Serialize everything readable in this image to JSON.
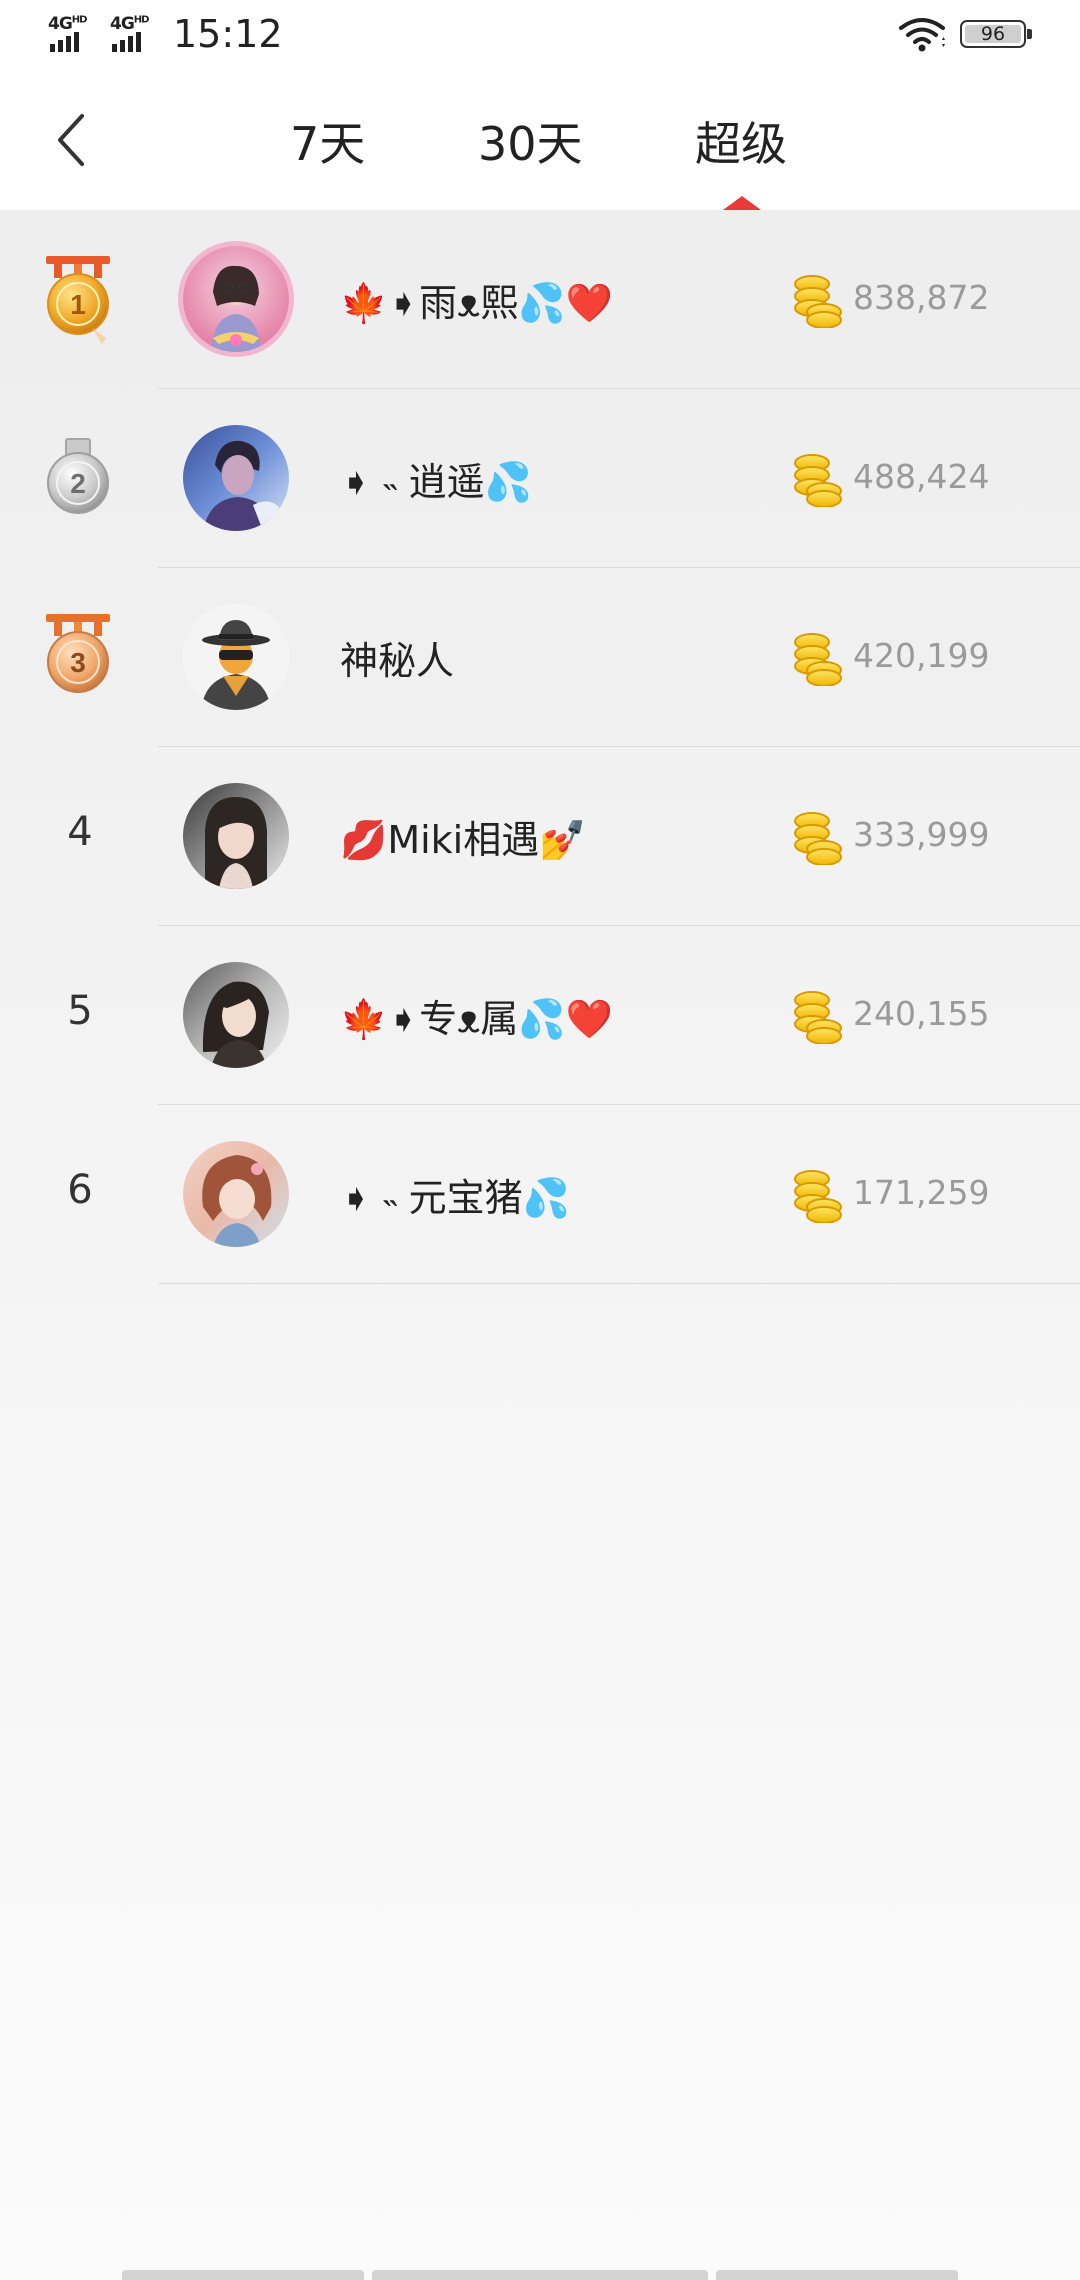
{
  "status_bar": {
    "signal_1_label": "4G",
    "signal_1_sup": "HD",
    "signal_2_label": "4G",
    "signal_2_sup": "HD",
    "time": "15:12",
    "battery": "96"
  },
  "header": {
    "back_icon": "chevron-left-icon",
    "tabs": [
      {
        "label": "7天"
      },
      {
        "label": "30天"
      },
      {
        "label": "超级"
      }
    ],
    "active_tab": 2,
    "accent_color": "#e83a3a"
  },
  "ranking": [
    {
      "rank": "1",
      "medal": "gold",
      "name": "🍁➧雨ᴥ熙💦❤️",
      "score": "838,872"
    },
    {
      "rank": "2",
      "medal": "silver",
      "name": "➧ ˵ 逍遥💦",
      "score": "488,424"
    },
    {
      "rank": "3",
      "medal": "bronze",
      "name": "神秘人",
      "score": "420,199"
    },
    {
      "rank": "4",
      "medal": "",
      "name": "💋Miki相遇💅",
      "score": "333,999"
    },
    {
      "rank": "5",
      "medal": "",
      "name": "🍁➧专ᴥ属💦❤️",
      "score": "240,155"
    },
    {
      "rank": "6",
      "medal": "",
      "name": "➧ ˵ 元宝猪💦",
      "score": "171,259"
    }
  ]
}
